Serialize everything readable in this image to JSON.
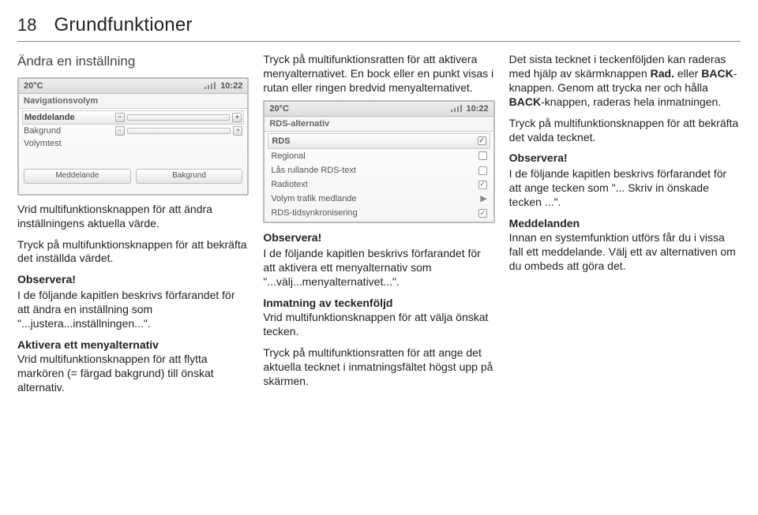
{
  "header": {
    "page_number": "18",
    "title": "Grundfunktioner"
  },
  "col1": {
    "subhead": "Ändra en inställning",
    "shot": {
      "temp": "20°C",
      "clock": "10:22",
      "menu_title": "Navigationsvolym",
      "rows": [
        "Meddelande",
        "Bakgrund",
        "Volymtest"
      ],
      "bottom": [
        "Meddelande",
        "Bakgrund"
      ]
    },
    "p1": "Vrid multifunktionsknappen för att ändra inställningens aktuella värde.",
    "p2": "Tryck på multifunktionsknappen för att bekräfta det inställda värdet.",
    "obs_title": "Observera!",
    "obs_body": "I de följande kapitlen beskrivs förfarandet för att ändra en inställning som \"...justera...inställningen...\".",
    "p3_lead": "Aktivera ett menyalternativ",
    "p3_rest": "Vrid multifunktionsknappen för att flytta markören (= färgad bakgrund) till önskat alternativ."
  },
  "col2": {
    "p1": "Tryck på multifunktionsratten för att aktivera menyalternativet. En bock eller en punkt visas i rutan eller ringen bredvid menyalternativet.",
    "shot": {
      "temp": "20°C",
      "clock": "10:22",
      "menu_title": "RDS-alternativ",
      "rows": [
        {
          "label": "RDS",
          "mark": "check"
        },
        {
          "label": "Regional",
          "mark": "empty"
        },
        {
          "label": "Lås rullande RDS-text",
          "mark": "empty"
        },
        {
          "label": "Radiotext",
          "mark": "check"
        },
        {
          "label": "Volym trafik medlande",
          "mark": "arrow"
        },
        {
          "label": "RDS-tidsynkronisering",
          "mark": "check"
        }
      ]
    },
    "obs_title": "Observera!",
    "obs_body": "I de följande kapitlen beskrivs förfarandet för att aktivera ett menyalternativ som \"...välj...menyalternativet...\".",
    "p2_lead": "Inmatning av teckenföljd",
    "p2_rest": "Vrid multifunktionsknappen för att välja önskat tecken.",
    "p3": "Tryck på multifunktionsratten för att ange det aktuella tecknet i inmatningsfältet högst upp på skärmen."
  },
  "col3": {
    "p1a": "Det sista tecknet i teckenföljden kan raderas med hjälp av skärmknappen ",
    "p1b": "Rad.",
    "p1c": " eller ",
    "p1d": "BACK",
    "p1e": "-knappen. Genom att trycka ner och hålla ",
    "p1f": "BACK",
    "p1g": "-knappen, raderas hela inmatningen.",
    "p2": "Tryck på multifunktionsknappen för att bekräfta det valda tecknet.",
    "obs_title": "Observera!",
    "obs_body": "I de följande kapitlen beskrivs förfarandet för att ange tecken som \"... Skriv in önskade tecken ...\".",
    "p3_lead": "Meddelanden",
    "p3_rest": "Innan en systemfunktion utförs får du i vissa fall ett meddelande. Välj ett av alternativen om du ombeds att göra det."
  }
}
